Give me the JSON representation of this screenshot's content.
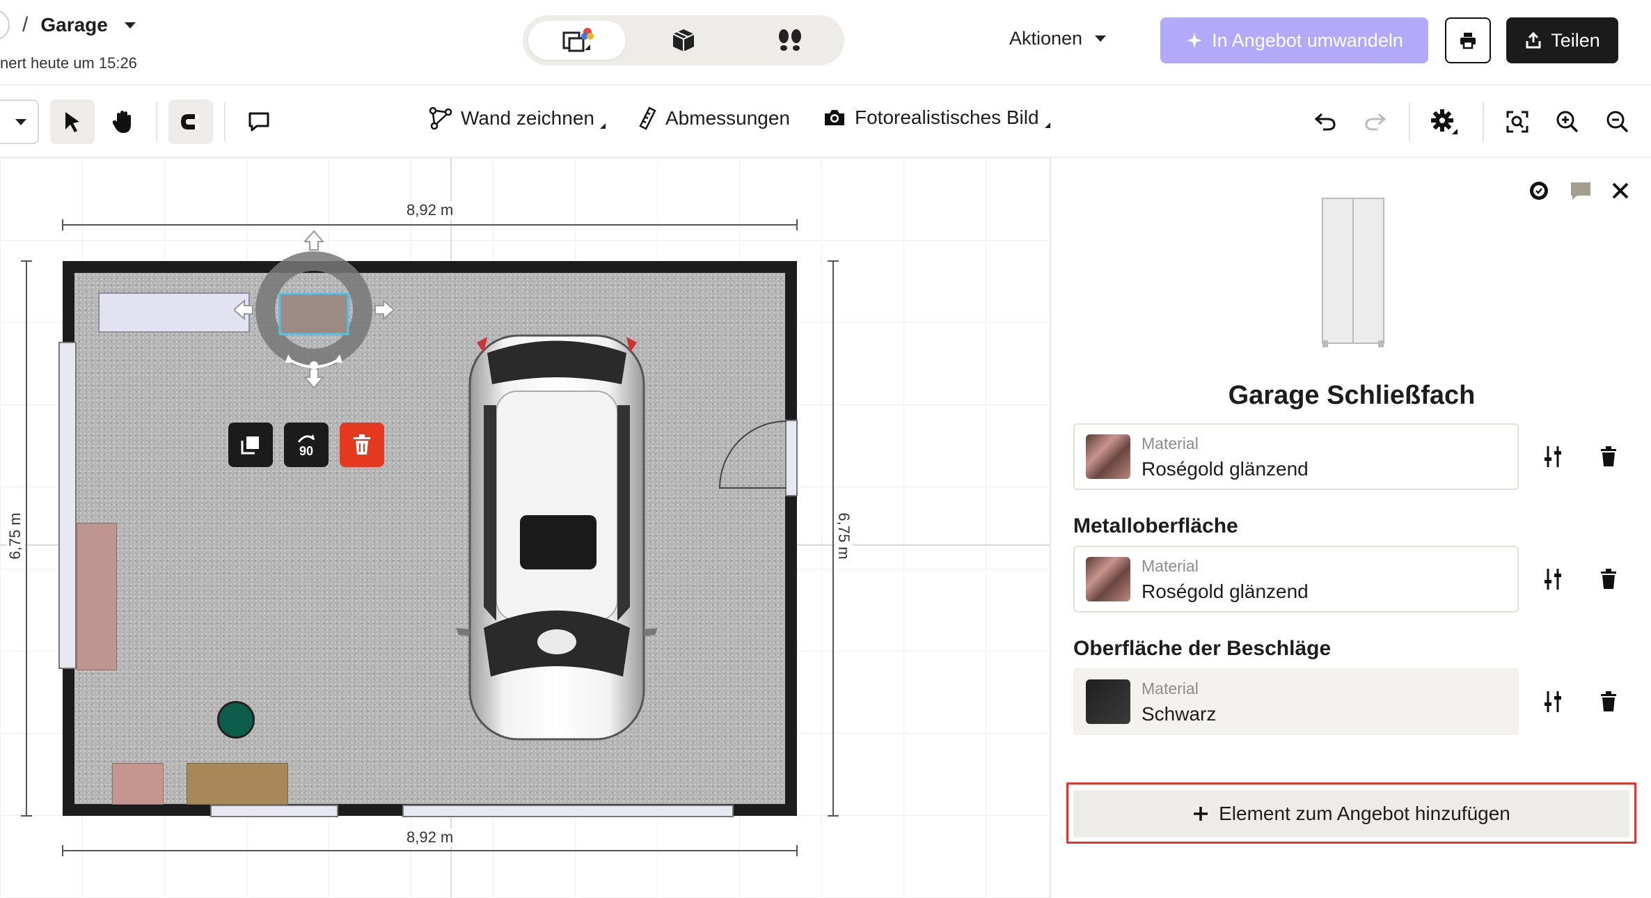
{
  "header": {
    "breadcrumb_sep": "/",
    "project_name": "Garage",
    "saved_status": "nert heute um 15:26",
    "view_modes": [
      {
        "name": "2d-plan",
        "icon": "floorplan-icon",
        "active": true
      },
      {
        "name": "3d-view",
        "icon": "cube-icon",
        "active": false
      },
      {
        "name": "walk-view",
        "icon": "footsteps-icon",
        "active": false
      }
    ],
    "actions_label": "Aktionen",
    "convert_label": "In Angebot umwandeln",
    "share_label": "Teilen"
  },
  "toolbar": {
    "draw_wall_label": "Wand zeichnen",
    "dimensions_label": "Abmessungen",
    "photo_label": "Fotorealistisches Bild"
  },
  "canvas": {
    "dim_top": "8,92 m",
    "dim_bottom": "8,92 m",
    "dim_left": "6,75 m",
    "dim_right": "6,75 m",
    "rotate_label": "90"
  },
  "panel": {
    "product_title": "Garage Schließfach",
    "sections": [
      {
        "title": "",
        "material_label": "Material",
        "material_value": "Roségold glänzend",
        "swatch": "#8a5a52"
      },
      {
        "title": "Metalloberfläche",
        "material_label": "Material",
        "material_value": "Roségold glänzend",
        "swatch": "#8a5a52"
      },
      {
        "title": "Oberfläche der Beschläge",
        "material_label": "Material",
        "material_value": "Schwarz",
        "swatch": "#2b2b2b"
      }
    ],
    "add_button_label": "Element zum Angebot hinzufügen"
  },
  "colors": {
    "accent_purple": "#b3a9fb",
    "highlight_red": "#e0362c",
    "delete_red": "#e5391f",
    "dark": "#1b1b1b"
  }
}
